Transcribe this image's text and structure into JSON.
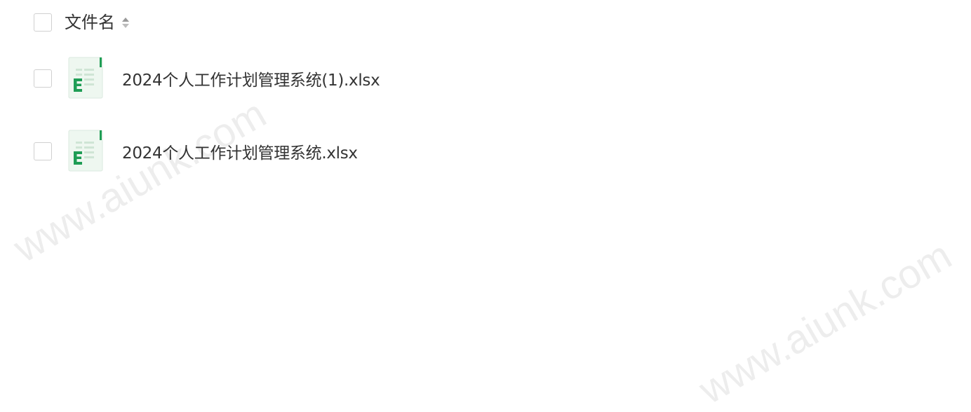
{
  "header": {
    "column_label": "文件名",
    "sort_icon": "sort-updown-icon"
  },
  "files": [
    {
      "name": "2024个人工作计划管理系统(1).xlsx",
      "icon": "excel-file-icon"
    },
    {
      "name": "2024个人工作计划管理系统.xlsx",
      "icon": "excel-file-icon"
    }
  ],
  "watermark": {
    "text": "www.aiunk.com"
  },
  "colors": {
    "excel_green": "#1f9d55",
    "checkbox_border": "#d0d0d0",
    "text": "#333333"
  }
}
